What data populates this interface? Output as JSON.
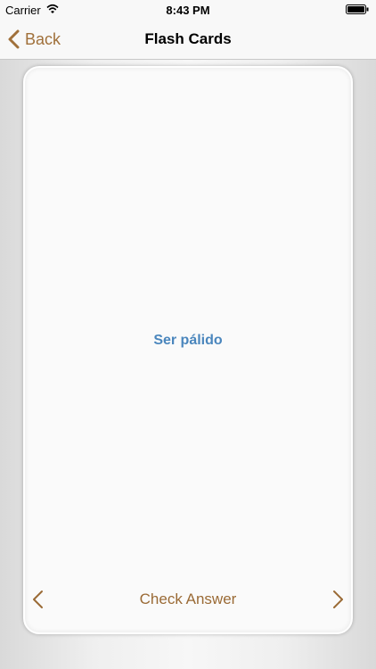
{
  "status_bar": {
    "carrier": "Carrier",
    "time": "8:43 PM",
    "wifi_icon": "wifi-icon",
    "battery_icon": "battery-icon"
  },
  "nav_bar": {
    "back_label": "Back",
    "title": "Flash Cards"
  },
  "card": {
    "word": "Ser pálido",
    "check_answer_label": "Check Answer",
    "prev_icon": "chevron-left-icon",
    "next_icon": "chevron-right-icon"
  },
  "colors": {
    "accent": "#a0703a",
    "word": "#4a86bd"
  }
}
